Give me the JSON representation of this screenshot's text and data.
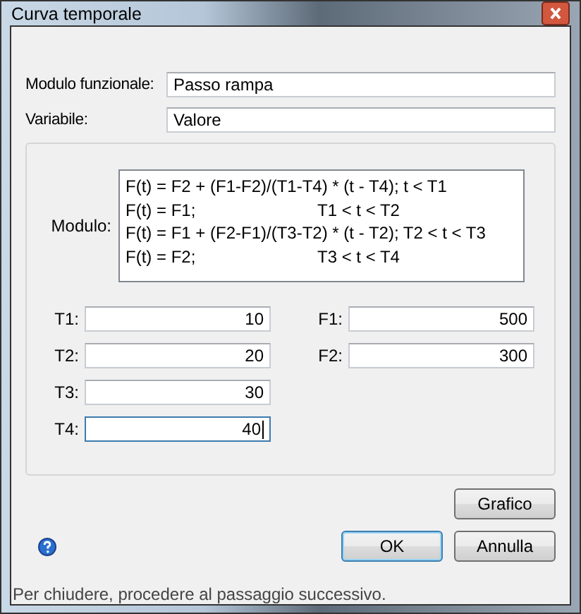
{
  "window": {
    "title": "Curva temporale"
  },
  "fields": [
    {
      "label": "Modulo funzionale:",
      "value": "Passo rampa"
    },
    {
      "label": "Variabile:",
      "value": "Valore"
    }
  ],
  "formula": {
    "label": "Modulo:",
    "lines": [
      "F(t) = F2 + (F1-F2)/(T1-T4) * (t - T4); t < T1",
      "F(t) = F1;\tT1 < t < T2",
      "F(t) = F1 + (F2-F1)/(T3-T2) * (t - T2); T2 < t < T3",
      "F(t) = F2;\tT3 < t < T4"
    ]
  },
  "times": [
    {
      "label": "T1:",
      "value": "10",
      "focused": false
    },
    {
      "label": "T2:",
      "value": "20",
      "focused": false
    },
    {
      "label": "T3:",
      "value": "30",
      "focused": false
    },
    {
      "label": "T4:",
      "value": "40",
      "focused": true
    }
  ],
  "forces": [
    {
      "label": "F1:",
      "value": "500",
      "focused": false
    },
    {
      "label": "F2:",
      "value": "300",
      "focused": false
    }
  ],
  "buttons": [
    {
      "label": "Grafico",
      "default": false
    },
    {
      "label": "OK",
      "default": true
    },
    {
      "label": "Annulla",
      "default": false
    }
  ],
  "status_bar": "Per chiudere, procedere al passaggio successivo."
}
